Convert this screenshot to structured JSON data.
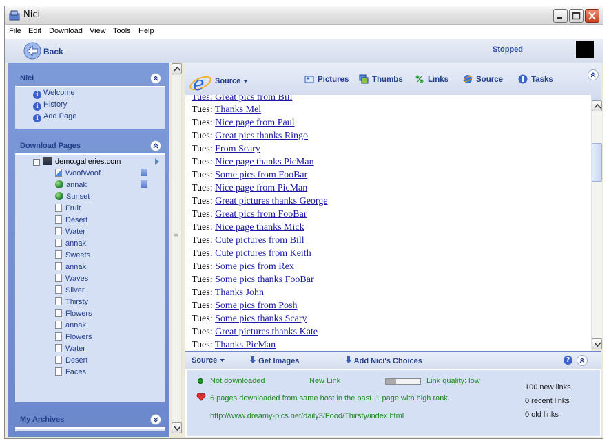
{
  "window": {
    "title": "Nici"
  },
  "menu": [
    "File",
    "Edit",
    "Download",
    "View",
    "Tools",
    "Help"
  ],
  "toolbar": {
    "back_label": "Back",
    "status": "Stopped"
  },
  "nici_panel": {
    "title": "Nici",
    "items": [
      "Welcome",
      "History",
      "Add Page"
    ]
  },
  "download_panel": {
    "title": "Download Pages",
    "root": "demo.galleries.com",
    "children": [
      {
        "label": "WoofWoof",
        "icon": "page-globe-icon"
      },
      {
        "label": "annak",
        "icon": "globe-icon"
      },
      {
        "label": "Sunset",
        "icon": "globe-icon"
      },
      {
        "label": "Fruit",
        "icon": "page-icon"
      },
      {
        "label": "Desert",
        "icon": "page-icon"
      },
      {
        "label": "Water",
        "icon": "page-icon"
      },
      {
        "label": "annak",
        "icon": "page-icon"
      },
      {
        "label": "Sweets",
        "icon": "page-icon"
      },
      {
        "label": "annak",
        "icon": "page-icon"
      },
      {
        "label": "Waves",
        "icon": "page-icon"
      },
      {
        "label": "Silver",
        "icon": "page-icon"
      },
      {
        "label": "Thirsty",
        "icon": "page-icon"
      },
      {
        "label": "Flowers",
        "icon": "page-icon"
      },
      {
        "label": "annak",
        "icon": "page-icon"
      },
      {
        "label": "Flowers",
        "icon": "page-icon"
      },
      {
        "label": "Water",
        "icon": "page-icon"
      },
      {
        "label": "Desert",
        "icon": "page-icon"
      },
      {
        "label": "Faces",
        "icon": "page-icon"
      }
    ]
  },
  "archives_panel": {
    "title": "My Archives"
  },
  "view_toolbar": {
    "source_dropdown": "Source",
    "buttons": [
      "Pictures",
      "Thumbs",
      "Links",
      "Source",
      "Tasks"
    ]
  },
  "content": {
    "partial_top": "Tues: Great pics from Bill",
    "prefix": "Tues:",
    "links": [
      "Thanks Mel",
      "Nice page from Paul",
      "Great pics thanks Ringo",
      "From Scary",
      "Nice page thanks PicMan",
      "Some pics from FooBar",
      "Nice page from PicMan",
      "Great pictures thanks George",
      "Great pics from FooBar",
      "Nice page thanks Mick",
      "Cute pictures from Bill",
      "Cute pictures from Keith",
      "Some pics from Rex",
      "Some pics thanks FooBar",
      "Thanks John",
      "Some pics from Posh",
      "Some pics thanks Scary",
      "Great pictures thanks Kate",
      "Thanks PicMan"
    ]
  },
  "bottom": {
    "source_dropdown": "Source",
    "get_images": "Get Images",
    "add_choices": "Add Nici's Choices",
    "not_downloaded": "Not downloaded",
    "new_link": "New Link",
    "link_quality": "Link quality: low",
    "link_quality_level": 0.3,
    "history_note": "6 pages downloaded from same host in the past. 1 page  with high rank.",
    "url": "http://www.dreamy-pics.net/daily3/Food/Thirsty/index.html",
    "new_links": "100 new links",
    "recent_links": "0 recent links",
    "old_links": "0 old links"
  },
  "colors": {
    "accent": "#233f8a",
    "link": "#1a1aa6",
    "panel": "#d6e0f5",
    "status_green": "#1f8a1f"
  }
}
